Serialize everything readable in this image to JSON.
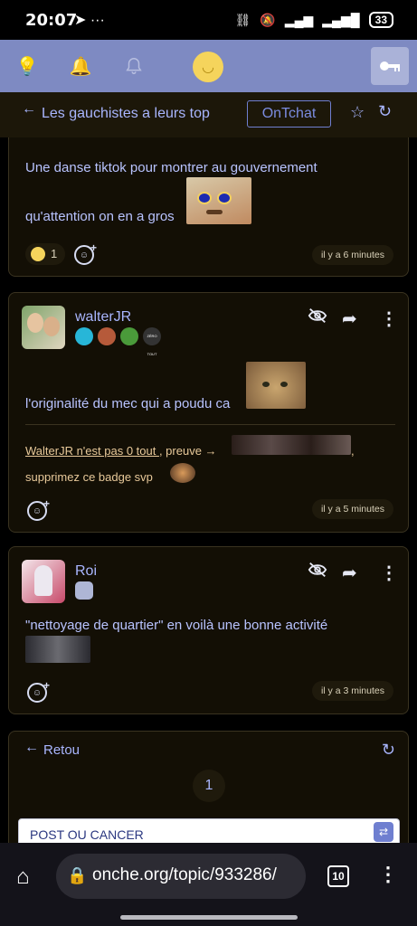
{
  "status_bar": {
    "time": "20:07",
    "battery": "33"
  },
  "topic": {
    "back_arrow": "←",
    "title": "Les gauchistes a leurs top",
    "ontchat_label": "OnTchat"
  },
  "posts": [
    {
      "line1": "Une danse tiktok pour montrer au gouvernement",
      "line2": "qu'attention on en a gros",
      "reaction_count": "1",
      "time": "il y a 6 minutes"
    },
    {
      "username": "walterJR",
      "text": "l'originalité du mec qui a poudu ca",
      "quote_link": "WalterJR n'est pas 0 tout ",
      "quote_rest": ", preuve →",
      "quote_end": ",",
      "line3": "supprimez ce badge svp",
      "badge_zero": "ZÉRO TOUT",
      "time": "il y a 5 minutes"
    },
    {
      "username": "Roi",
      "text": "\"nettoyage de quartier\" en voilà une bonne activité",
      "time": "il y a 3 minutes"
    }
  ],
  "pagination": {
    "back_label": "Retou",
    "page": "1"
  },
  "composer": {
    "value": "POST OU CANCER"
  },
  "browser": {
    "url": "onche.org/topic/933286/",
    "tab_count": "10"
  },
  "colors": {
    "nav": "#7e8ac2",
    "card_bg": "#130f05",
    "link": "#a9b6ff",
    "gold_link": "#e8c99a"
  }
}
